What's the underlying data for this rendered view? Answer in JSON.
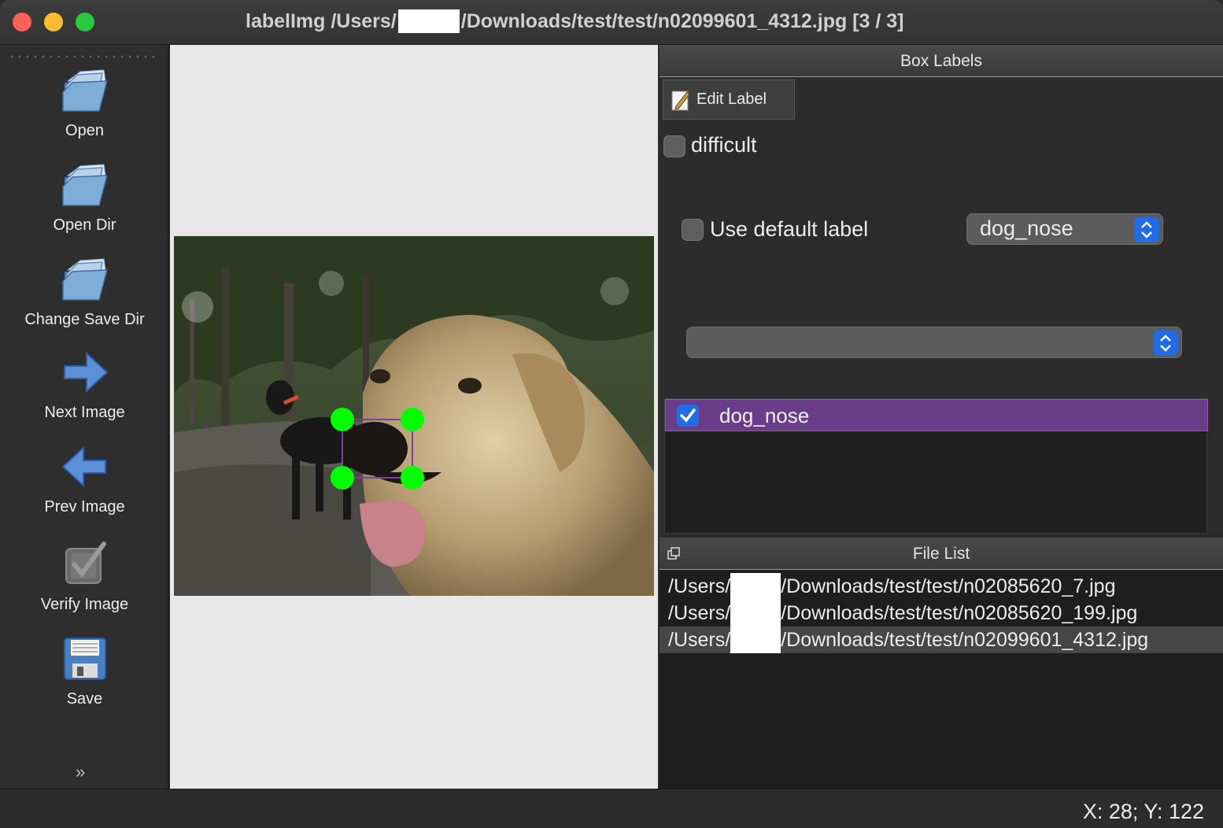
{
  "window": {
    "title_prefix": "labelImg /Users/",
    "title_suffix": "/Downloads/test/test/n02099601_4312.jpg [3 / 3]"
  },
  "toolbar": {
    "items": [
      {
        "label": "Open",
        "icon": "folder-icon"
      },
      {
        "label": "Open Dir",
        "icon": "folder-icon"
      },
      {
        "label": "Change Save Dir",
        "icon": "folder-icon"
      },
      {
        "label": "Next Image",
        "icon": "arrow-right-icon"
      },
      {
        "label": "Prev Image",
        "icon": "arrow-left-icon"
      },
      {
        "label": "Verify Image",
        "icon": "checkbox-icon"
      },
      {
        "label": "Save",
        "icon": "floppy-icon"
      }
    ],
    "more_icon": "double-chevron-down-icon"
  },
  "canvas": {
    "image": "golden retriever photo with bounding box on nose",
    "box_color": "#7a3fa0",
    "handle_color": "#00ff00"
  },
  "box_labels": {
    "title": "Box Labels",
    "edit_label": "Edit Label",
    "difficult": "difficult",
    "use_default_label": "Use default label",
    "default_label_value": "dog_nose",
    "label_combo_value": "",
    "labels": [
      {
        "text": "dog_nose",
        "checked": true,
        "color": "#6a3d8a"
      }
    ]
  },
  "file_list": {
    "title": "File List",
    "prefix": "/Users/",
    "files": [
      {
        "suffix": "/Downloads/test/test/n02085620_7.jpg"
      },
      {
        "suffix": "/Downloads/test/test/n02085620_199.jpg"
      },
      {
        "suffix": "/Downloads/test/test/n02099601_4312.jpg",
        "selected": true
      }
    ]
  },
  "status": {
    "coords": "X: 28; Y: 122"
  }
}
